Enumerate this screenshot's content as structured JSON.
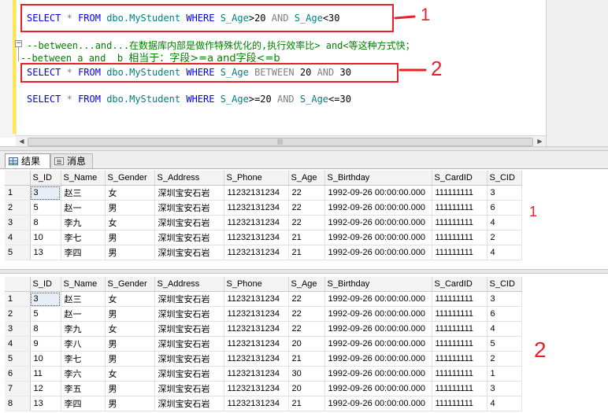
{
  "editor": {
    "line1": {
      "kw1": "SELECT",
      "star": "*",
      "kw2": "FROM",
      "obj": "dbo.MyStudent",
      "kw3": "WHERE",
      "col1": "S_Age",
      "op1": ">20",
      "kw4": "AND",
      "col2": "S_Age",
      "op2": "<30"
    },
    "comment1": "--between...and...在数据库内部是做作特殊优化的,执行效率比> and<等这种方式快；",
    "comment2": {
      "part1": "--between a and  b ",
      "part2": "相当于：字段>=a and字段<=b"
    },
    "line2": {
      "kw1": "SELECT",
      "star": "*",
      "kw2": "FROM",
      "obj": "dbo.MyStudent",
      "kw3": "WHERE",
      "col": "S_Age",
      "kw4": "BETWEEN",
      "v1": "20",
      "kw5": "AND",
      "v2": "30"
    },
    "line3": {
      "kw1": "SELECT",
      "star": "*",
      "kw2": "FROM",
      "obj": "dbo.MyStudent",
      "kw3": "WHERE",
      "col1": "S_Age",
      "op1": ">=20",
      "kw4": "AND",
      "col2": "S_Age",
      "op2": "<=30"
    },
    "annotation1": "1",
    "annotation2": "2",
    "collapse_glyph": "−",
    "scroll_grip": "|||"
  },
  "tabs": {
    "results_label": "结果",
    "messages_label": "消息"
  },
  "grid_annotations": {
    "first": "1",
    "second": "2"
  },
  "grid1": {
    "columns": [
      "",
      "S_ID",
      "S_Name",
      "S_Gender",
      "S_Address",
      "S_Phone",
      "S_Age",
      "S_Birthday",
      "S_CardID",
      "S_CID"
    ],
    "rows": [
      [
        "1",
        "3",
        "赵三",
        "女",
        "深圳宝安石岩",
        "11232131234",
        "22",
        "1992-09-26 00:00:00.000",
        "111111111",
        "3"
      ],
      [
        "2",
        "5",
        "赵一",
        "男",
        "深圳宝安石岩",
        "11232131234",
        "22",
        "1992-09-26 00:00:00.000",
        "111111111",
        "6"
      ],
      [
        "3",
        "8",
        "李九",
        "女",
        "深圳宝安石岩",
        "11232131234",
        "22",
        "1992-09-26 00:00:00.000",
        "111111111",
        "4"
      ],
      [
        "4",
        "10",
        "李七",
        "男",
        "深圳宝安石岩",
        "11232131234",
        "21",
        "1992-09-26 00:00:00.000",
        "111111111",
        "2"
      ],
      [
        "5",
        "13",
        "李四",
        "男",
        "深圳宝安石岩",
        "11232131234",
        "21",
        "1992-09-26 00:00:00.000",
        "111111111",
        "4"
      ]
    ]
  },
  "grid2": {
    "columns": [
      "",
      "S_ID",
      "S_Name",
      "S_Gender",
      "S_Address",
      "S_Phone",
      "S_Age",
      "S_Birthday",
      "S_CardID",
      "S_CID"
    ],
    "rows": [
      [
        "1",
        "3",
        "赵三",
        "女",
        "深圳宝安石岩",
        "11232131234",
        "22",
        "1992-09-26 00:00:00.000",
        "111111111",
        "3"
      ],
      [
        "2",
        "5",
        "赵一",
        "男",
        "深圳宝安石岩",
        "11232131234",
        "22",
        "1992-09-26 00:00:00.000",
        "111111111",
        "6"
      ],
      [
        "3",
        "8",
        "李九",
        "女",
        "深圳宝安石岩",
        "11232131234",
        "22",
        "1992-09-26 00:00:00.000",
        "111111111",
        "4"
      ],
      [
        "4",
        "9",
        "李八",
        "男",
        "深圳宝安石岩",
        "11232131234",
        "20",
        "1992-09-26 00:00:00.000",
        "111111111",
        "5"
      ],
      [
        "5",
        "10",
        "李七",
        "男",
        "深圳宝安石岩",
        "11232131234",
        "21",
        "1992-09-26 00:00:00.000",
        "111111111",
        "2"
      ],
      [
        "6",
        "11",
        "李六",
        "女",
        "深圳宝安石岩",
        "11232131234",
        "30",
        "1992-09-26 00:00:00.000",
        "111111111",
        "1"
      ],
      [
        "7",
        "12",
        "李五",
        "男",
        "深圳宝安石岩",
        "11232131234",
        "20",
        "1992-09-26 00:00:00.000",
        "111111111",
        "3"
      ],
      [
        "8",
        "13",
        "李四",
        "男",
        "深圳宝安石岩",
        "11232131234",
        "21",
        "1992-09-26 00:00:00.000",
        "111111111",
        "4"
      ]
    ]
  },
  "colors": {
    "annotation": "#e8202a",
    "keyword": "#0000ff",
    "comment": "#008000",
    "object": "#008080"
  }
}
